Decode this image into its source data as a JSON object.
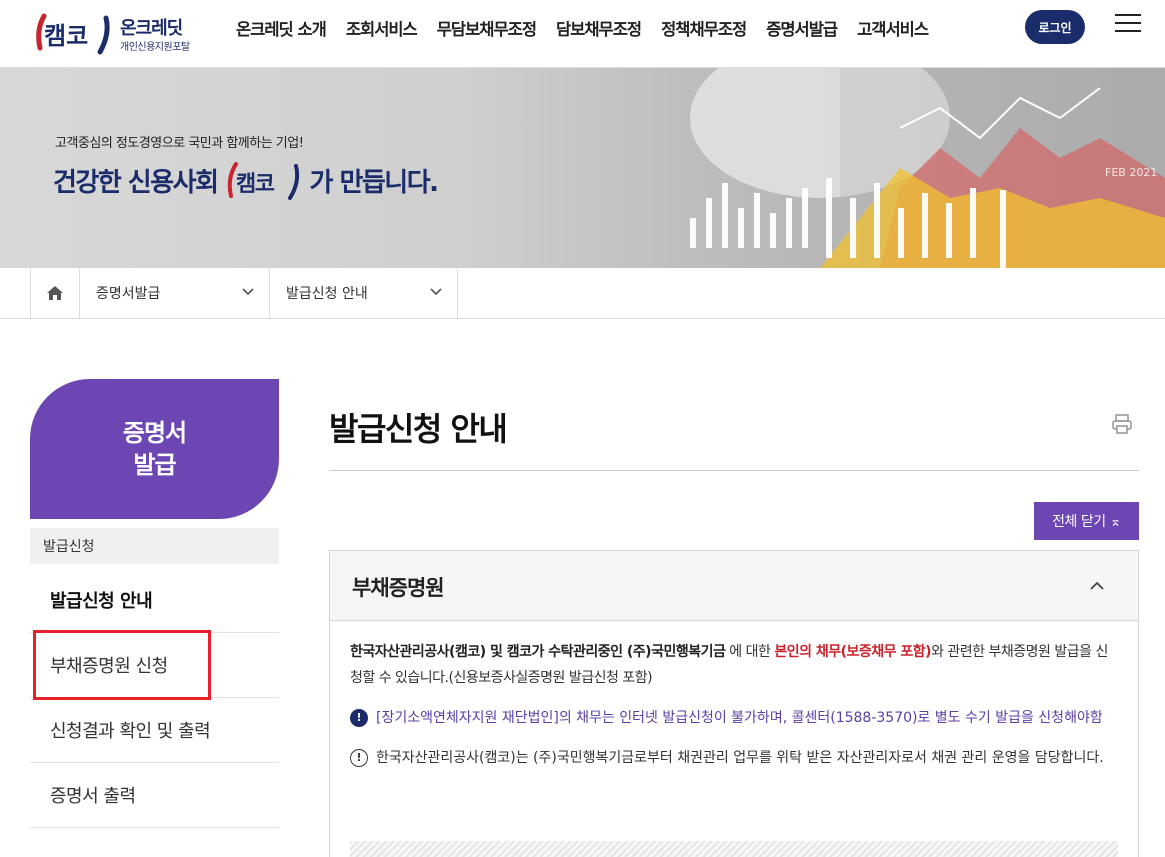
{
  "header": {
    "logo_name": "온크레딧",
    "logo_sub": "개인신용지원포탈",
    "nav": [
      "온크레딧 소개",
      "조회서비스",
      "무담보채무조정",
      "담보채무조정",
      "정책채무조정",
      "증명서발급",
      "고객서비스"
    ],
    "login_label": "로그인"
  },
  "banner": {
    "subtitle": "고객중심의 정도경영으로 국민과 함께하는 기업!",
    "title_before": "건강한 신용사회",
    "title_after": "가 만듭니다."
  },
  "breadcrumb": {
    "level1": "증명서발급",
    "level2": "발급신청 안내"
  },
  "sidebar": {
    "heading_line1": "증명서",
    "heading_line2": "발급",
    "group_label": "발급신청",
    "items": [
      {
        "label": "발급신청 안내",
        "active": true
      },
      {
        "label": "부채증명원 신청",
        "active": false
      },
      {
        "label": "신청결과 확인 및 출력",
        "active": false
      },
      {
        "label": "증명서 출력",
        "active": false
      }
    ]
  },
  "main": {
    "page_title": "발급신청 안내",
    "close_all_label": "전체 닫기 ⌅",
    "accordion": {
      "title": "부채증명원",
      "para_bold": "한국자산관리공사(캠코) 및 캠코가 수탁관리중인 (주)국민행복기금",
      "para_mid": " 에 대한 ",
      "para_red": "본인의 채무(보증채무 포함)",
      "para_end": "와 관련한 부채증명원 발급을 신청할 수 있습니다.(신용보증사실증명원 발급신청 포함)",
      "note1": "[장기소액연체자지원 재단법인]의 채무는 인터넷 발급신청이 불가하며, 콜센터(1588-3570)로 별도 수기 발급을 신청해야함",
      "note2": "한국자산관리공사(캠코)는 (주)국민행복기금로부터 채권관리 업무를 위탁 받은 자산관리자로서 채권 관리 운영을 담당합니다."
    }
  },
  "colors": {
    "brand_navy": "#1b2c6b",
    "brand_purple": "#6c46b3",
    "highlight_red": "#e8202a"
  },
  "icons": {
    "home": "home-icon",
    "print": "print-icon",
    "menu": "hamburger-icon",
    "chevron": "chevron-down-icon"
  }
}
